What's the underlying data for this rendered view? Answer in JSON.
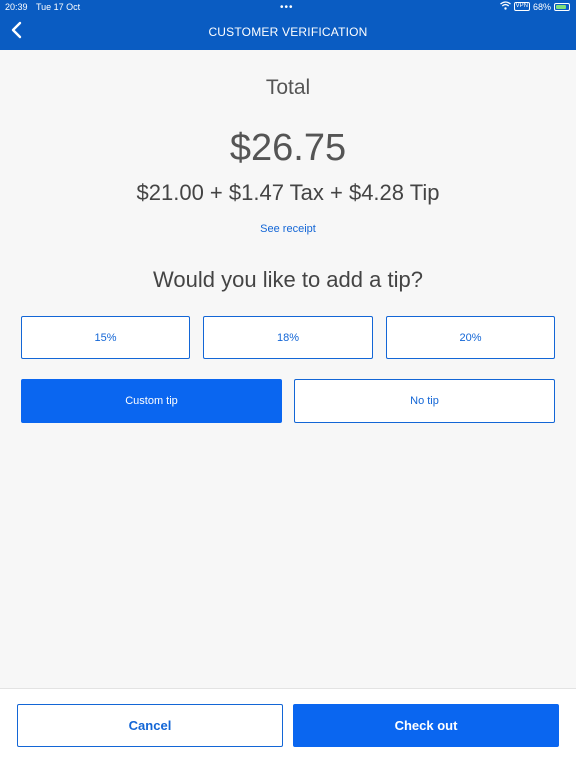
{
  "status_bar": {
    "time": "20:39",
    "date": "Tue 17 Oct",
    "dots": "•••",
    "vpn": "VPN",
    "battery": "68%"
  },
  "header": {
    "title": "CUSTOMER VERIFICATION",
    "back_icon": "chevron-left-icon"
  },
  "summary": {
    "total_label": "Total",
    "total_amount": "$26.75",
    "breakdown": "$21.00 + $1.47 Tax + $4.28 Tip",
    "see_receipt": "See receipt"
  },
  "tip": {
    "question": "Would you like to add a tip?",
    "options": [
      "15%",
      "18%",
      "20%"
    ],
    "custom_tip": "Custom tip",
    "no_tip": "No tip"
  },
  "footer": {
    "cancel": "Cancel",
    "checkout": "Check out"
  },
  "colors": {
    "header_bg": "#0a5cc2",
    "accent": "#0a66f0",
    "link": "#1366d6"
  }
}
